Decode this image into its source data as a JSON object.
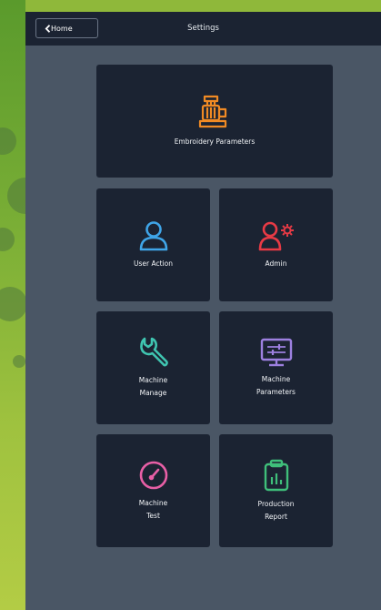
{
  "header": {
    "back_label": "Home",
    "title": "Settings"
  },
  "tiles": [
    {
      "label": "Embroidery Parameters",
      "icon": "embroidery-machine-icon",
      "color": "#f08a24"
    },
    {
      "label": "User Action",
      "icon": "user-icon",
      "color": "#3fa5e8"
    },
    {
      "label": "Admin",
      "icon": "admin-gear-icon",
      "color": "#e83a45"
    },
    {
      "label": "Machine\nManage",
      "icon": "wrench-icon",
      "color": "#3fc4b0"
    },
    {
      "label": "Machine\nParameters",
      "icon": "monitor-settings-icon",
      "color": "#9d80e0"
    },
    {
      "label": "Machine\nTest",
      "icon": "gauge-icon",
      "color": "#e85fa6"
    },
    {
      "label": "Production\nReport",
      "icon": "clipboard-chart-icon",
      "color": "#3fbf7a"
    }
  ]
}
